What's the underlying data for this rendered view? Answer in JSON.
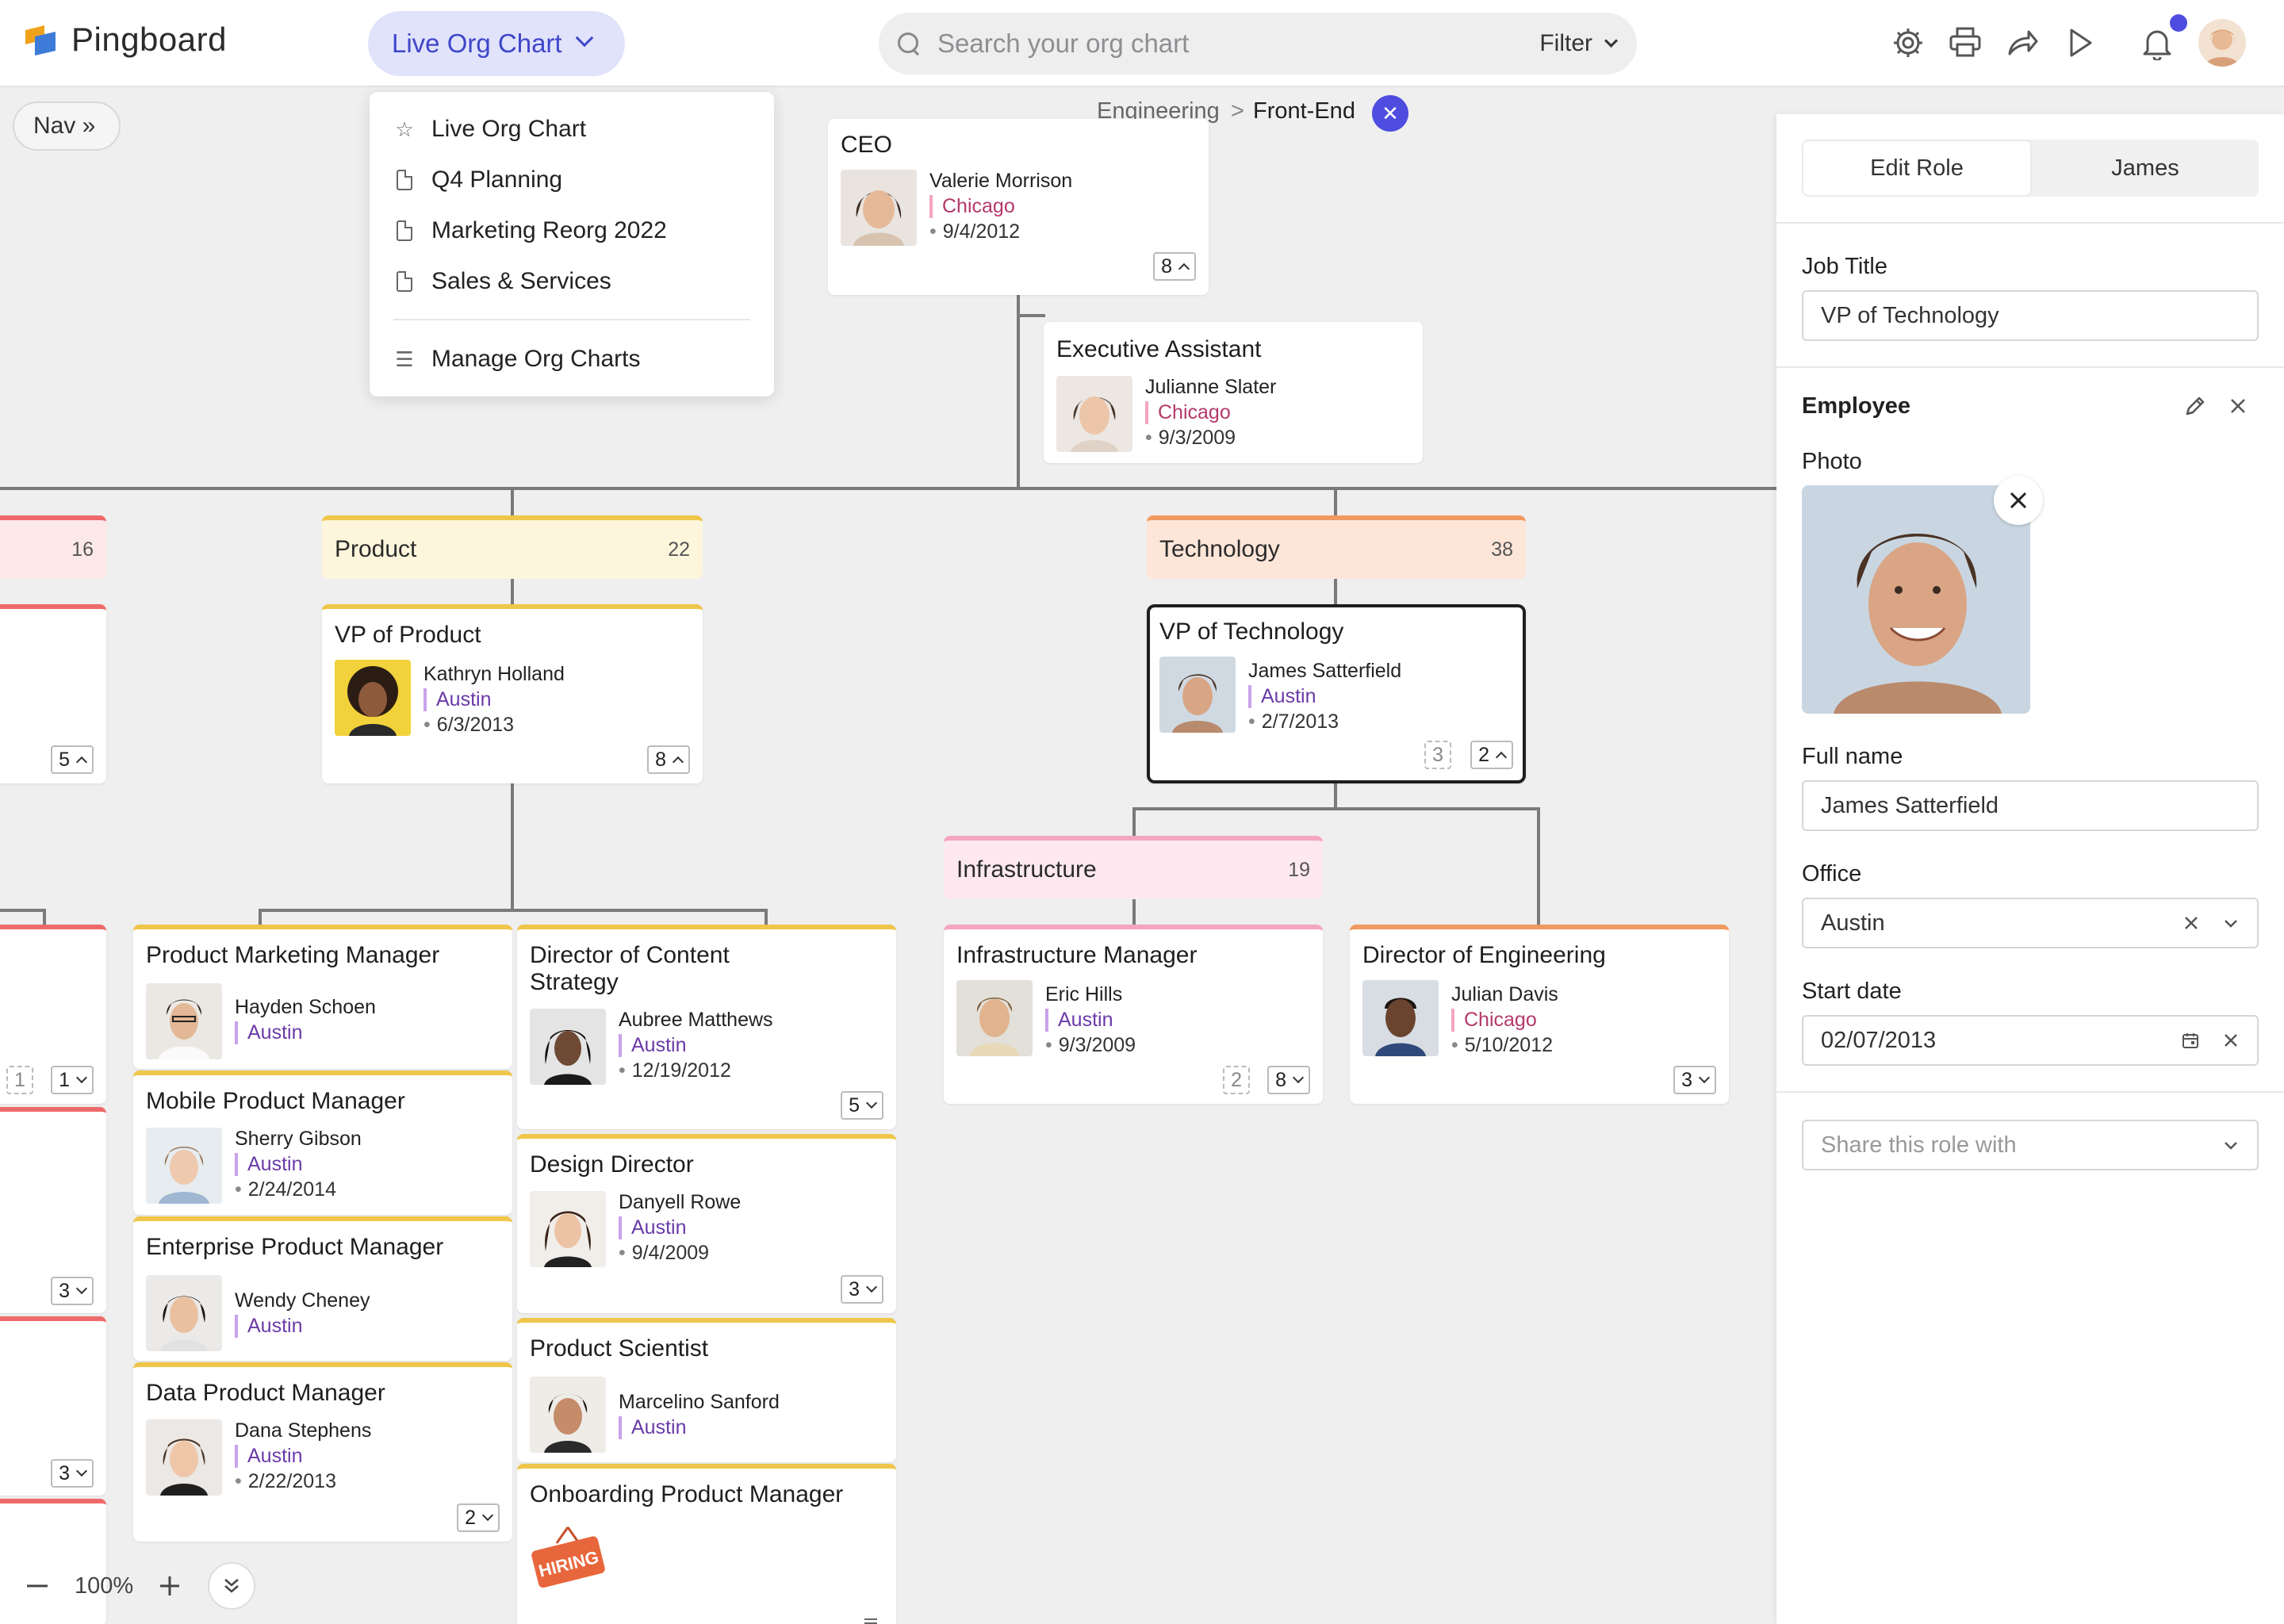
{
  "app": {
    "name": "Pingboard"
  },
  "header": {
    "chart_selector": "Live Org Chart",
    "search_placeholder": "Search your org chart",
    "filter_label": "Filter",
    "icons": [
      "gear-icon",
      "printer-icon",
      "share-icon",
      "play-icon",
      "bell-icon"
    ]
  },
  "dropdown": {
    "items": [
      "Live Org Chart",
      "Q4 Planning",
      "Marketing Reorg 2022",
      "Sales & Services"
    ],
    "manage": "Manage Org Charts"
  },
  "nav": {
    "label": "Nav »"
  },
  "breadcrumb": {
    "parent": "Engineering",
    "sep": ">",
    "current": "Front-End"
  },
  "org": {
    "ceo": {
      "title": "CEO",
      "name": "Valerie Morrison",
      "office": "Chicago",
      "date": "9/4/2012",
      "reports": "8"
    },
    "assistant": {
      "title": "Executive Assistant",
      "name": "Julianne Slater",
      "office": "Chicago",
      "date": "9/3/2009"
    },
    "left_team": {
      "count": "16",
      "reports": "5"
    },
    "product_team": {
      "name": "Product",
      "count": "22"
    },
    "vp_product": {
      "title": "VP of Product",
      "name": "Kathryn Holland",
      "office": "Austin",
      "date": "6/3/2013",
      "reports": "8"
    },
    "tech_team": {
      "name": "Technology",
      "count": "38"
    },
    "vp_tech": {
      "title": "VP of Technology",
      "name": "James Satterfield",
      "office": "Austin",
      "date": "2/7/2013",
      "open": "3",
      "reports": "2"
    },
    "infra_team": {
      "name": "Infrastructure",
      "count": "19"
    },
    "infra_mgr": {
      "title": "Infrastructure Manager",
      "name": "Eric Hills",
      "office": "Austin",
      "date": "9/3/2009",
      "open": "2",
      "reports": "8"
    },
    "dir_eng": {
      "title": "Director of Engineering",
      "name": "Julian Davis",
      "office": "Chicago",
      "date": "5/10/2012",
      "reports": "3"
    },
    "pmm": {
      "title": "Product Marketing Manager",
      "name": "Hayden Schoen",
      "office": "Austin"
    },
    "mpm": {
      "title": "Mobile Product Manager",
      "name": "Sherry Gibson",
      "office": "Austin",
      "date": "2/24/2014"
    },
    "epm": {
      "title": "Enterprise Product Manager",
      "name": "Wendy Cheney",
      "office": "Austin"
    },
    "dpm": {
      "title": "Data Product Manager",
      "name": "Dana Stephens",
      "office": "Austin",
      "date": "2/22/2013",
      "reports": "2"
    },
    "dcs": {
      "title1": "Director of Content",
      "title2": "Strategy",
      "name": "Aubree Matthews",
      "office": "Austin",
      "date": "12/19/2012",
      "reports": "5"
    },
    "dd": {
      "title": "Design Director",
      "name": "Danyell Rowe",
      "office": "Austin",
      "date": "9/4/2009",
      "reports": "3"
    },
    "ps": {
      "title": "Product Scientist",
      "name": "Marcelino Sanford",
      "office": "Austin"
    },
    "opm": {
      "title": "Onboarding Product Manager",
      "badge": "HIRING"
    },
    "left_col": {
      "a_open": "1",
      "a_reports": "1",
      "b_reports": "3",
      "c_reports": "3"
    }
  },
  "panel": {
    "tabs": [
      "Edit Role",
      "James"
    ],
    "job_title_label": "Job Title",
    "job_title_value": "VP of Technology",
    "employee_label": "Employee",
    "photo_label": "Photo",
    "full_name_label": "Full name",
    "full_name_value": "James Satterfield",
    "office_label": "Office",
    "office_value": "Austin",
    "start_date_label": "Start date",
    "start_date_value": "02/07/2013",
    "share_placeholder": "Share this role with"
  },
  "zoom": {
    "level": "100%"
  },
  "colors": {
    "accent": "#4f4de0",
    "product": "#f0c64a",
    "technology": "#f09a60",
    "infrastructure": "#f4a6c0",
    "left_team": "#ee6a6a"
  }
}
